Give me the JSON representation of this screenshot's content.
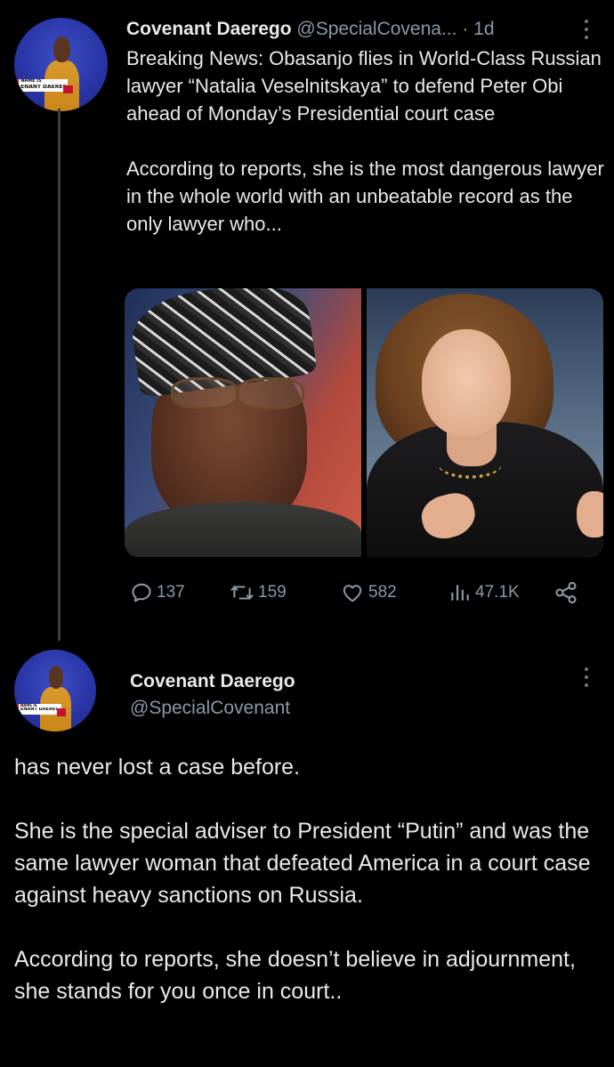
{
  "tweet1": {
    "author_name": "Covenant Daerego",
    "handle": "@SpecialCovena...",
    "separator": "·",
    "time": "1d",
    "avatar_banner_line1": "NAME IS",
    "avatar_banner_line2": "ENANT DAEREG",
    "text": "Breaking News: Obasanjo flies in World-Class Russian lawyer “Natalia Veselnitskaya” to defend Peter Obi ahead of Monday’s Presidential court case\n\nAccording to reports, she is the most dangerous lawyer in the whole world with an unbeatable record as the only lawyer who...",
    "media": [
      {
        "alt_icon": "photo-obasanjo"
      },
      {
        "alt_icon": "photo-veselnitskaya"
      }
    ],
    "actions": {
      "replies": "137",
      "retweets": "159",
      "likes": "582",
      "views": "47.1K"
    }
  },
  "tweet2": {
    "author_name": "Covenant Daerego",
    "handle": "@SpecialCovenant",
    "avatar_banner_line1": "NAME IS",
    "avatar_banner_line2": "ENANT DAEREG",
    "paragraphs": [
      "has never lost a case before.",
      "She is the special adviser to President “Putin” and was the same lawyer woman that defeated America in a court case against heavy sanctions on Russia.",
      "According to reports, she doesn’t believe in adjournment, she stands for you once in court.."
    ]
  },
  "colors": {
    "background": "#000000",
    "text": "#e7e9ea",
    "secondary": "#8b98a5",
    "thread_line": "#3a3d41"
  }
}
